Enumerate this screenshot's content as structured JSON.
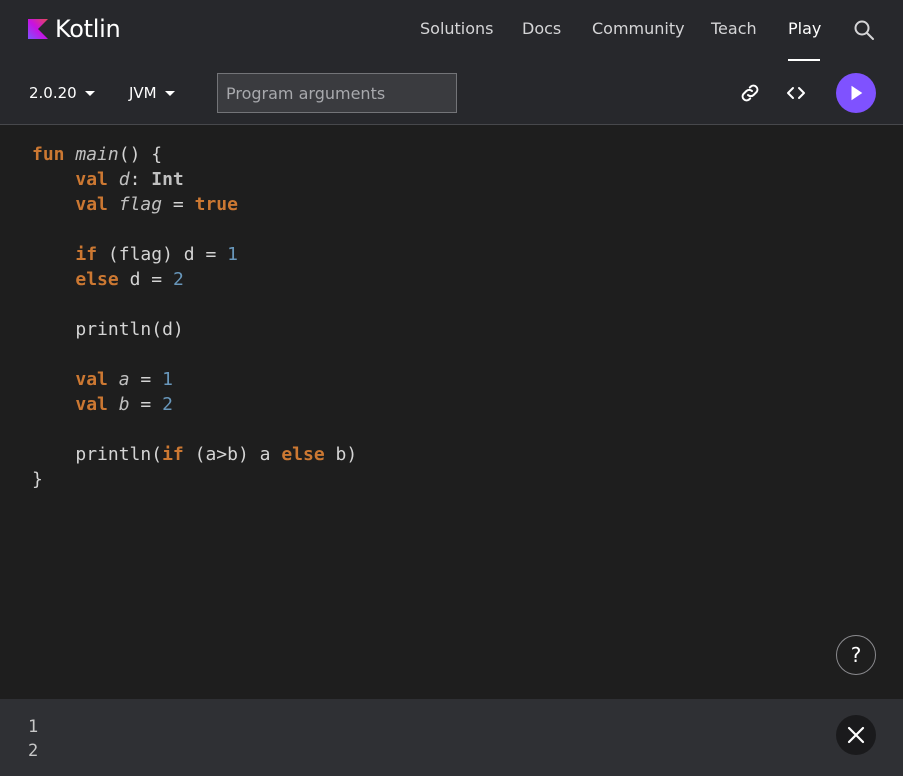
{
  "brand": {
    "name": "Kotlin",
    "logo_colors": [
      "#7f52ff",
      "#c811e1",
      "#e54857"
    ]
  },
  "nav": {
    "items": [
      {
        "label": "Solutions",
        "active": false
      },
      {
        "label": "Docs",
        "active": false
      },
      {
        "label": "Community",
        "active": false
      },
      {
        "label": "Teach",
        "active": false
      },
      {
        "label": "Play",
        "active": true
      }
    ],
    "search_icon": "search-icon"
  },
  "toolbar": {
    "version": "2.0.20",
    "target": "JVM",
    "args_placeholder": "Program arguments",
    "args_value": "",
    "link_icon": "link-icon",
    "embed_icon": "code-brackets-icon",
    "run_icon": "play-icon",
    "run_color": "#7f52ff"
  },
  "editor": {
    "lines": [
      {
        "text": "fun main() {"
      },
      {
        "text": "    val d: Int"
      },
      {
        "text": "    val flag = true"
      },
      {
        "text": ""
      },
      {
        "text": "    if (flag) d = 1"
      },
      {
        "text": "    else d = 2"
      },
      {
        "text": ""
      },
      {
        "text": "    println(d)"
      },
      {
        "text": ""
      },
      {
        "text": "    val a = 1"
      },
      {
        "text": "    val b = 2"
      },
      {
        "text": ""
      },
      {
        "text": "    println(if (a>b) a else b)"
      },
      {
        "text": "}"
      }
    ],
    "help_label": "?"
  },
  "output": {
    "lines": [
      "1",
      "2"
    ],
    "close_icon": "close-icon"
  }
}
